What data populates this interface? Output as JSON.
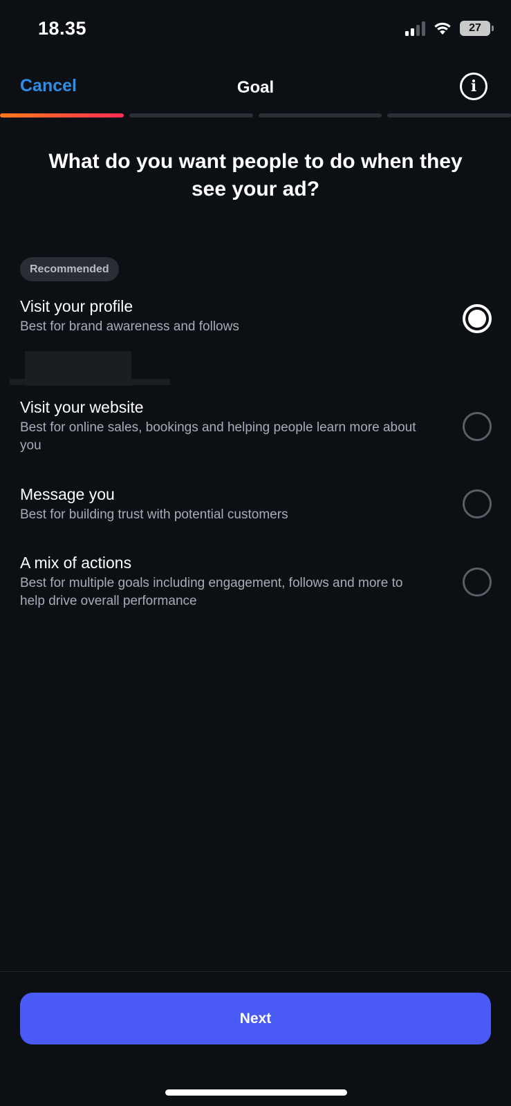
{
  "status_bar": {
    "time": "18.35",
    "battery": "27",
    "signal_icon": "cellular-signal-icon",
    "wifi_icon": "wifi-icon"
  },
  "header": {
    "cancel_label": "Cancel",
    "title": "Goal",
    "info_icon": "info-icon"
  },
  "progress": {
    "total_steps": 4,
    "current_step": 1
  },
  "question": "What do you want people to do when they see your ad?",
  "badge": "Recommended",
  "options": [
    {
      "title": "Visit your profile",
      "desc": "Best for brand awareness and follows",
      "selected": true
    },
    {
      "title": "Visit your website",
      "desc": "Best for online sales, bookings and helping people learn more about you",
      "selected": false
    },
    {
      "title": "Message you",
      "desc": "Best for building trust with potential customers",
      "selected": false
    },
    {
      "title": "A mix of actions",
      "desc": "Best for multiple goals including engagement, follows and more to help drive overall performance",
      "selected": false
    }
  ],
  "footer": {
    "next_label": "Next"
  },
  "colors": {
    "background": "#0c0f14",
    "accent_link": "#2f8de4",
    "primary_button": "#4a5bf5",
    "progress_active_start": "#ff7a1a",
    "progress_active_end": "#ff2d55"
  }
}
